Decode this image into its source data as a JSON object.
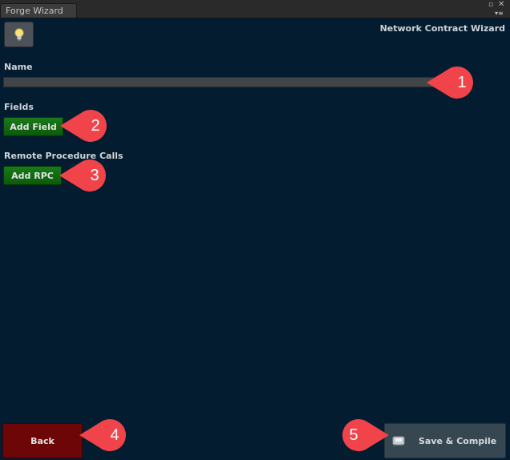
{
  "window": {
    "tab_title": "Forge Wizard"
  },
  "header": {
    "wizard_title": "Network Contract Wizard",
    "hint_icon": "lightbulb-icon"
  },
  "name_section": {
    "label": "Name",
    "value": ""
  },
  "fields_section": {
    "label": "Fields",
    "button_label": "Add Field"
  },
  "rpc_section": {
    "label": "Remote Procedure Calls",
    "button_label": "Add RPC"
  },
  "footer": {
    "back_label": "Back",
    "save_label": "Save & Compile",
    "save_icon": "save-icon"
  },
  "callouts": [
    "1",
    "2",
    "3",
    "4",
    "5"
  ],
  "colors": {
    "background": "#031c30",
    "add_button": "#0f6a0f",
    "back_button": "#6d0606",
    "save_button": "#364751",
    "callout": "#f0444a"
  }
}
